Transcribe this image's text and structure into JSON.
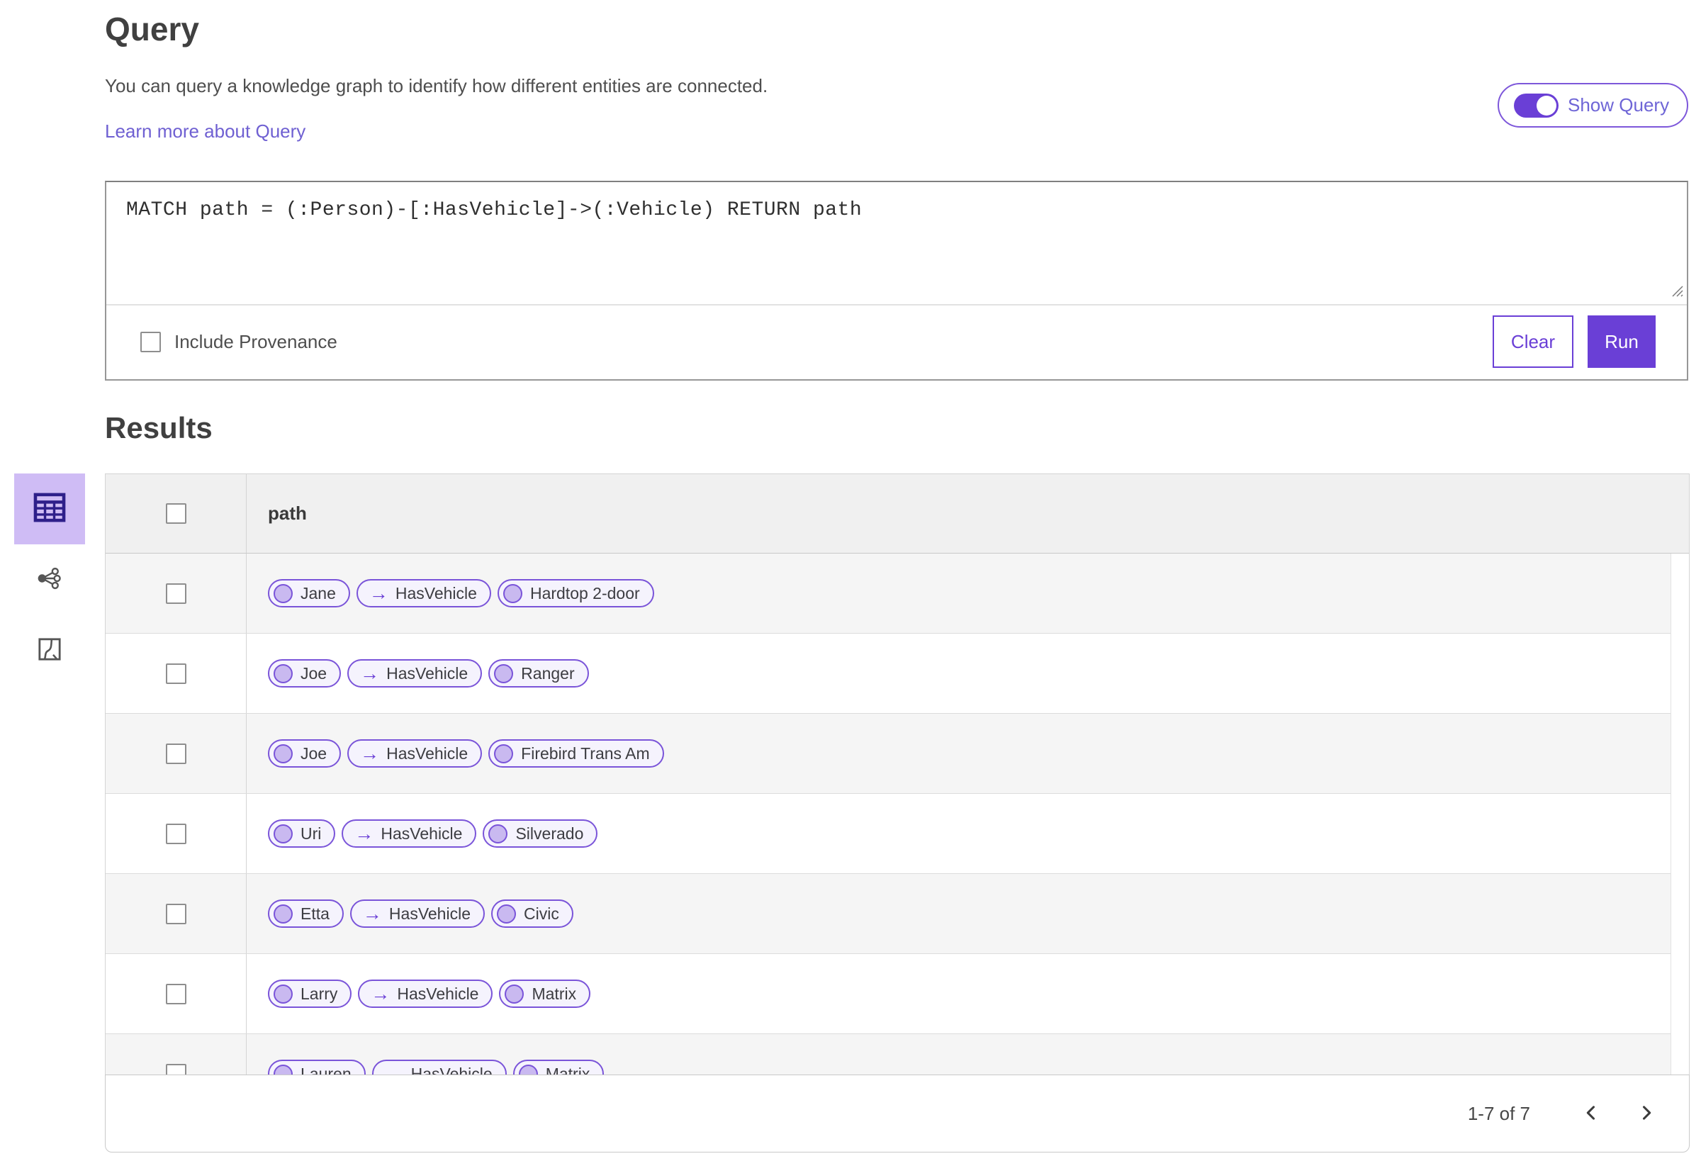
{
  "query_section": {
    "title": "Query",
    "description": "You can query a knowledge graph to identify how different entities are connected.",
    "learn_more_link": "Learn more about Query",
    "show_query_toggle": {
      "label": "Show Query",
      "enabled": true
    },
    "editor": {
      "query_text": "MATCH path = (:Person)-[:HasVehicle]->(:Vehicle) RETURN path",
      "include_provenance": {
        "label": "Include Provenance",
        "checked": false
      },
      "clear_button": "Clear",
      "run_button": "Run"
    }
  },
  "results_section": {
    "title": "Results",
    "view_switcher": [
      {
        "icon": "table-view-icon",
        "selected": true
      },
      {
        "icon": "link-chart-view-icon",
        "selected": false
      },
      {
        "icon": "map-view-icon",
        "selected": false
      }
    ],
    "table": {
      "columns": [
        "path"
      ],
      "rows": [
        {
          "source": "Jane",
          "relationship": "HasVehicle",
          "target": "Hardtop 2-door"
        },
        {
          "source": "Joe",
          "relationship": "HasVehicle",
          "target": "Ranger"
        },
        {
          "source": "Joe",
          "relationship": "HasVehicle",
          "target": "Firebird Trans Am"
        },
        {
          "source": "Uri",
          "relationship": "HasVehicle",
          "target": "Silverado"
        },
        {
          "source": "Etta",
          "relationship": "HasVehicle",
          "target": "Civic"
        },
        {
          "source": "Larry",
          "relationship": "HasVehicle",
          "target": "Matrix"
        },
        {
          "source": "Lauren",
          "relationship": "HasVehicle",
          "target": "Matrix"
        }
      ]
    },
    "pagination": {
      "range_label": "1-7 of 7"
    }
  },
  "colors": {
    "accent": "#6a3fd6",
    "chip_border": "#7a54d9",
    "chip_background": "#f5f3fd",
    "chip_node_fill": "#c9b9f0",
    "link": "#6f60d2",
    "selected_view_background": "#cfbcf5"
  }
}
